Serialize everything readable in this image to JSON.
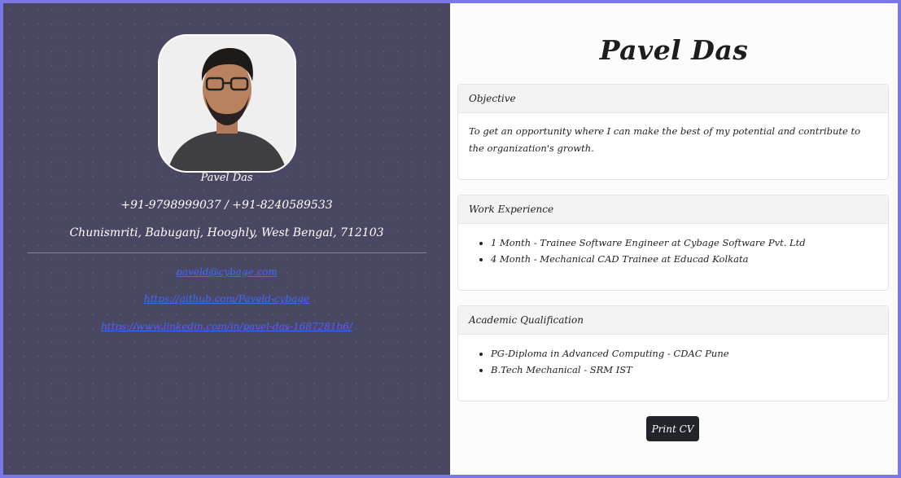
{
  "profile": {
    "name": "Pavel Das",
    "phone": "+91-9798999037 / +91-8240589533",
    "address": "Chunismriti, Babuganj, Hooghly, West Bengal, 712103",
    "email": "paveld@cybage.com",
    "github": "https://github.com/Paveld-cybage",
    "linkedin": "https://www.linkedin.com/in/pavel-das-1687281b6/"
  },
  "cv": {
    "title": "Pavel Das",
    "objective": {
      "heading": "Objective",
      "text": "To get an opportunity where I can make the best of my potential and contribute to the organization's growth."
    },
    "experience": {
      "heading": "Work Experience",
      "items": [
        "1 Month - Trainee Software Engineer at Cybage Software Pvt. Ltd",
        "4 Month - Mechanical CAD Trainee at Educad Kolkata"
      ]
    },
    "academic": {
      "heading": "Academic Qualification",
      "items": [
        "PG-Diploma in Advanced Computing - CDAC Pune",
        "B.Tech Mechanical - SRM IST"
      ]
    },
    "print_label": "Print CV"
  },
  "colors": {
    "sidebar_bg": "#4a4762",
    "frame_border": "#7b78e6",
    "link": "#3e6bff",
    "button_bg": "#212529"
  }
}
